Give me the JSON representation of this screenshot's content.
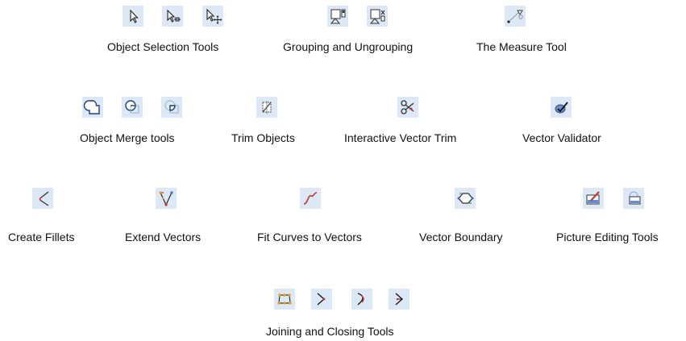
{
  "groups": {
    "object_selection": {
      "label": "Object Selection Tools",
      "icons": [
        "select-pointer-icon",
        "select-node-icon",
        "select-transform-icon"
      ]
    },
    "grouping": {
      "label": "Grouping and Ungrouping",
      "icons": [
        "group-icon",
        "ungroup-icon"
      ]
    },
    "measure": {
      "label": "The Measure Tool",
      "icons": [
        "measure-icon"
      ]
    },
    "merge": {
      "label": "Object Merge tools",
      "icons": [
        "merge-union-icon",
        "merge-subtract-icon",
        "merge-intersect-icon"
      ]
    },
    "trim_objects": {
      "label": "Trim Objects",
      "icons": [
        "trim-objects-icon"
      ]
    },
    "interactive_trim": {
      "label": "Interactive Vector Trim",
      "icons": [
        "scissors-icon"
      ]
    },
    "validator": {
      "label": "Vector Validator",
      "icons": [
        "vector-validator-icon"
      ]
    },
    "fillets": {
      "label": "Create Fillets",
      "icons": [
        "fillet-icon"
      ]
    },
    "extend": {
      "label": "Extend Vectors",
      "icons": [
        "extend-vectors-icon"
      ]
    },
    "fit_curves": {
      "label": "Fit Curves to Vectors",
      "icons": [
        "fit-curves-icon"
      ]
    },
    "boundary": {
      "label": "Vector Boundary",
      "icons": [
        "vector-boundary-icon"
      ]
    },
    "picture": {
      "label": "Picture Editing Tools",
      "icons": [
        "picture-edit-icon",
        "picture-crop-icon"
      ]
    },
    "joining": {
      "label": "Joining and Closing Tools",
      "icons": [
        "close-vector-icon",
        "join-straight-icon",
        "join-curve-icon",
        "join-point-icon"
      ]
    }
  },
  "colors": {
    "icon_background": "#dce8f5",
    "icon_accent_blue": "#2f6fc4",
    "icon_accent_red": "#d0312d",
    "icon_accent_orange": "#e8a020"
  }
}
